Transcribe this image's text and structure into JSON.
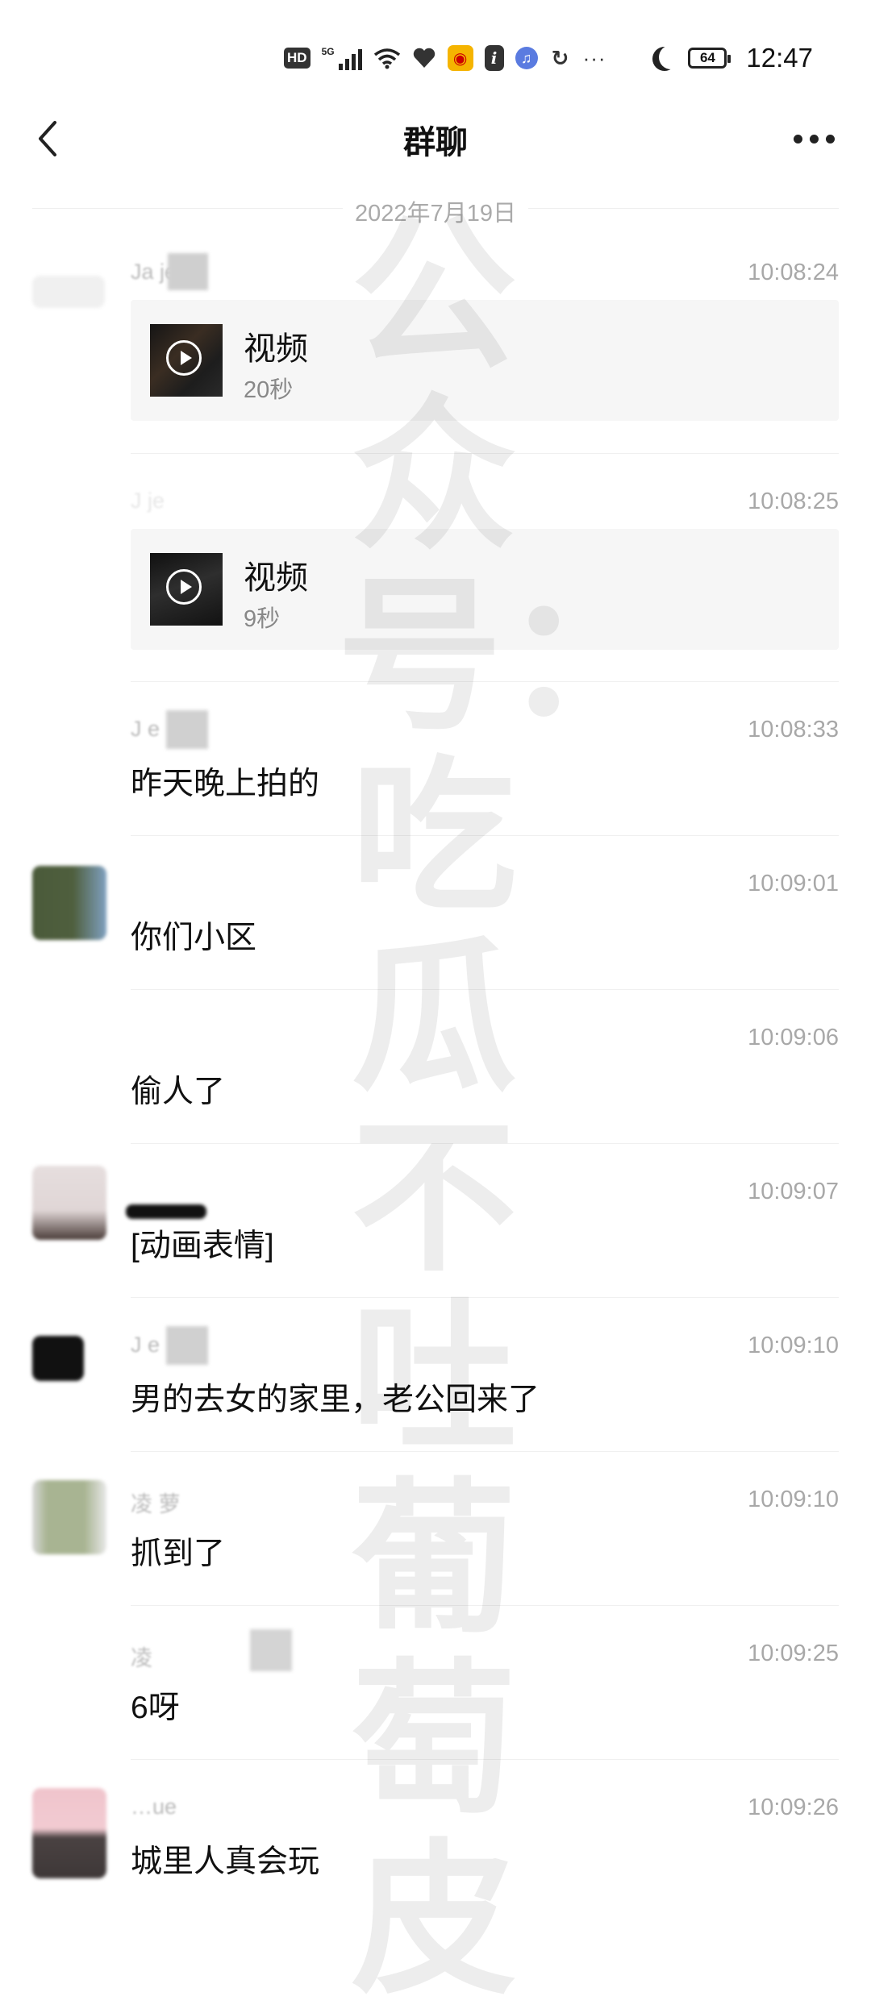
{
  "status_bar": {
    "hd": "HD",
    "network": "5G",
    "battery": "64",
    "time": "12:47",
    "icons": [
      "hd-icon",
      "signal-icon",
      "wifi-icon",
      "heart-icon",
      "weibo-icon",
      "info-icon",
      "music-icon",
      "sync-icon",
      "more-dots-icon",
      "moon-icon",
      "battery-icon"
    ]
  },
  "header": {
    "title": "群聊"
  },
  "date_divider": "2022年7月19日",
  "watermark": "公众号：吃瓜不吐葡萄皮",
  "messages": [
    {
      "sender": "Ja  je",
      "time": "10:08:24",
      "type": "video",
      "video_title": "视频",
      "duration": "20秒"
    },
    {
      "sender": "J   je",
      "time": "10:08:25",
      "type": "video",
      "video_title": "视频",
      "duration": "9秒"
    },
    {
      "sender": "J   e",
      "time": "10:08:33",
      "type": "text",
      "text": "昨天晚上拍的"
    },
    {
      "sender": "",
      "time": "10:09:01",
      "type": "text",
      "text": "你们小区"
    },
    {
      "sender": "",
      "time": "10:09:06",
      "type": "text",
      "text": "偷人了"
    },
    {
      "sender": "",
      "time": "10:09:07",
      "type": "text",
      "text": "[动画表情]"
    },
    {
      "sender": "J   e",
      "time": "10:09:10",
      "type": "text",
      "text": "男的去女的家里，老公回来了"
    },
    {
      "sender": "凌       萝",
      "time": "10:09:10",
      "type": "text",
      "text": "抓到了"
    },
    {
      "sender": "凌",
      "time": "10:09:25",
      "type": "text",
      "text": "6呀"
    },
    {
      "sender": "…ue",
      "time": "10:09:26",
      "type": "text",
      "text": "城里人真会玩"
    }
  ],
  "colors": {
    "background": "#ffffff",
    "video_card_bg": "#f6f6f6",
    "timestamp": "#a8a8a8",
    "date_text": "#aaaaaa"
  }
}
